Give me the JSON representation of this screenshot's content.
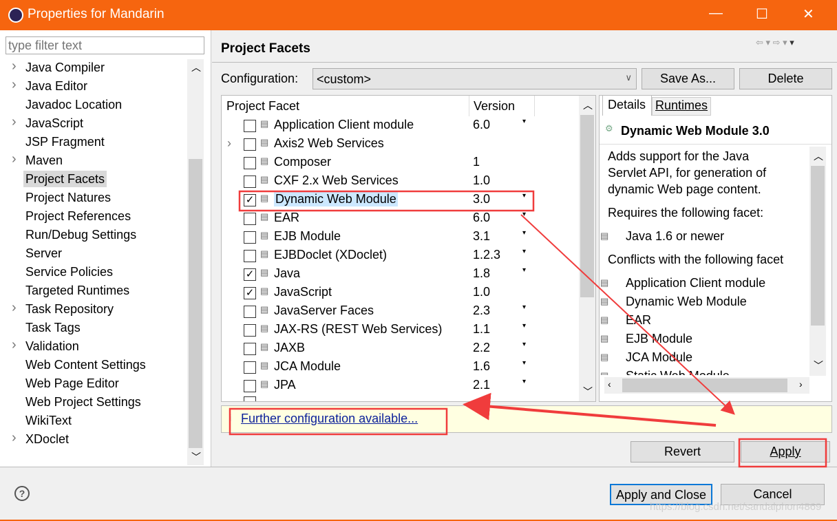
{
  "window": {
    "title": "Properties for Mandarin",
    "minimize": "—",
    "maximize": "☐",
    "close": "✕"
  },
  "filter": {
    "placeholder": "type filter text"
  },
  "tree": [
    {
      "label": "Java Compiler",
      "expandable": true
    },
    {
      "label": "Java Editor",
      "expandable": true
    },
    {
      "label": "Javadoc Location",
      "expandable": false
    },
    {
      "label": "JavaScript",
      "expandable": true
    },
    {
      "label": "JSP Fragment",
      "expandable": false
    },
    {
      "label": "Maven",
      "expandable": true
    },
    {
      "label": "Project Facets",
      "expandable": false,
      "selected": true
    },
    {
      "label": "Project Natures",
      "expandable": false
    },
    {
      "label": "Project References",
      "expandable": false
    },
    {
      "label": "Run/Debug Settings",
      "expandable": false
    },
    {
      "label": "Server",
      "expandable": false
    },
    {
      "label": "Service Policies",
      "expandable": false
    },
    {
      "label": "Targeted Runtimes",
      "expandable": false
    },
    {
      "label": "Task Repository",
      "expandable": true
    },
    {
      "label": "Task Tags",
      "expandable": false
    },
    {
      "label": "Validation",
      "expandable": true
    },
    {
      "label": "Web Content Settings",
      "expandable": false
    },
    {
      "label": "Web Page Editor",
      "expandable": false
    },
    {
      "label": "Web Project Settings",
      "expandable": false
    },
    {
      "label": "WikiText",
      "expandable": false
    },
    {
      "label": "XDoclet",
      "expandable": true
    }
  ],
  "page": {
    "title": "Project Facets",
    "config_label": "Configuration:",
    "config_value": "<custom>",
    "save_as": "Save As...",
    "delete": "Delete"
  },
  "table": {
    "col_facet": "Project Facet",
    "col_version": "Version",
    "rows": [
      {
        "name": "Application Client module",
        "version": "6.0",
        "checked": false,
        "dropdown": true
      },
      {
        "name": "Axis2 Web Services",
        "version": "",
        "checked": false,
        "dropdown": false,
        "expandable": true
      },
      {
        "name": "Composer",
        "version": "1",
        "checked": false,
        "dropdown": false
      },
      {
        "name": "CXF 2.x Web Services",
        "version": "1.0",
        "checked": false,
        "dropdown": false
      },
      {
        "name": "Dynamic Web Module",
        "version": "3.0",
        "checked": true,
        "dropdown": true,
        "selected": true
      },
      {
        "name": "EAR",
        "version": "6.0",
        "checked": false,
        "dropdown": true
      },
      {
        "name": "EJB Module",
        "version": "3.1",
        "checked": false,
        "dropdown": true
      },
      {
        "name": "EJBDoclet (XDoclet)",
        "version": "1.2.3",
        "checked": false,
        "dropdown": true
      },
      {
        "name": "Java",
        "version": "1.8",
        "checked": true,
        "dropdown": true
      },
      {
        "name": "JavaScript",
        "version": "1.0",
        "checked": true,
        "dropdown": false
      },
      {
        "name": "JavaServer Faces",
        "version": "2.3",
        "checked": false,
        "dropdown": true
      },
      {
        "name": "JAX-RS (REST Web Services)",
        "version": "1.1",
        "checked": false,
        "dropdown": true
      },
      {
        "name": "JAXB",
        "version": "2.2",
        "checked": false,
        "dropdown": true
      },
      {
        "name": "JCA Module",
        "version": "1.6",
        "checked": false,
        "dropdown": true
      },
      {
        "name": "JPA",
        "version": "2.1",
        "checked": false,
        "dropdown": true
      }
    ]
  },
  "details": {
    "tab_details": "Details",
    "tab_runtimes": "Runtimes",
    "title": "Dynamic Web Module 3.0",
    "description": [
      "Adds support for the Java",
      "Servlet API, for generation of",
      "dynamic Web page content."
    ],
    "requires_label": "Requires the following facet:",
    "requires": [
      "Java 1.6 or newer"
    ],
    "conflicts_label": "Conflicts with the following facet",
    "conflicts": [
      "Application Client module",
      "Dynamic Web Module",
      "EAR",
      "EJB Module",
      "JCA Module",
      "Static Web Module"
    ]
  },
  "info": {
    "icon": "info-icon",
    "link": "Further configuration available..."
  },
  "buttons": {
    "revert": "Revert",
    "apply": "Apply",
    "apply_close": "Apply and Close",
    "cancel": "Cancel"
  },
  "watermark": "https://blog.csdn.net/sandalphon4869",
  "colors": {
    "titlebar": "#f6650f",
    "annotation": "#f03c3c",
    "selection": "#cce8ff",
    "info_bg": "#ffffe1",
    "link": "#0b1f9a"
  }
}
